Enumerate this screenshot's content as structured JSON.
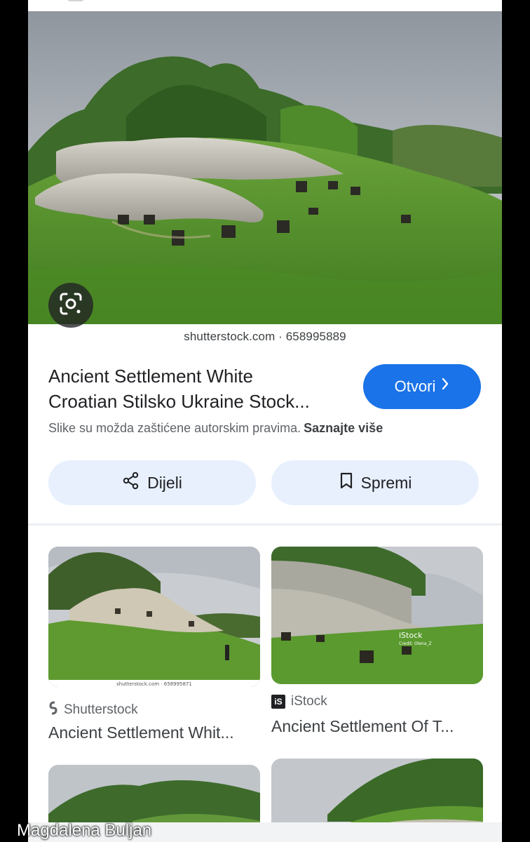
{
  "result": {
    "source_domain": "shutterstock.com · 658995889",
    "title_line1": "Ancient Settlement White",
    "title_line2": "Croatian Stilsko Ukraine Stock...",
    "open_label": "Otvori",
    "copyright_notice": "Slike su možda zaštićene autorskim pravima.",
    "learn_more_label": "Saznajte više"
  },
  "actions": {
    "share_label": "Dijeli",
    "save_label": "Spremi"
  },
  "related": [
    {
      "source": "Shutterstock",
      "title": "Ancient Settlement Whit...",
      "thumb_caption": "shutterstock.com · 658995871",
      "icon": "shutterstock-icon"
    },
    {
      "source": "iStock",
      "title": "Ancient Settlement Of T...",
      "thumb_caption": "iStock",
      "thumb_credit": "Credit: Olena_Z",
      "icon": "istock-icon"
    }
  ],
  "icons": {
    "lens": "google-lens-icon",
    "share": "share-icon",
    "save": "bookmark-icon",
    "open": "chevron-right-icon"
  },
  "colors": {
    "accent": "#1a73e8",
    "action_bg": "#e8f0fe",
    "text_primary": "#202124",
    "text_secondary": "#5f6368"
  },
  "watermark": "Magdalena Buljan"
}
